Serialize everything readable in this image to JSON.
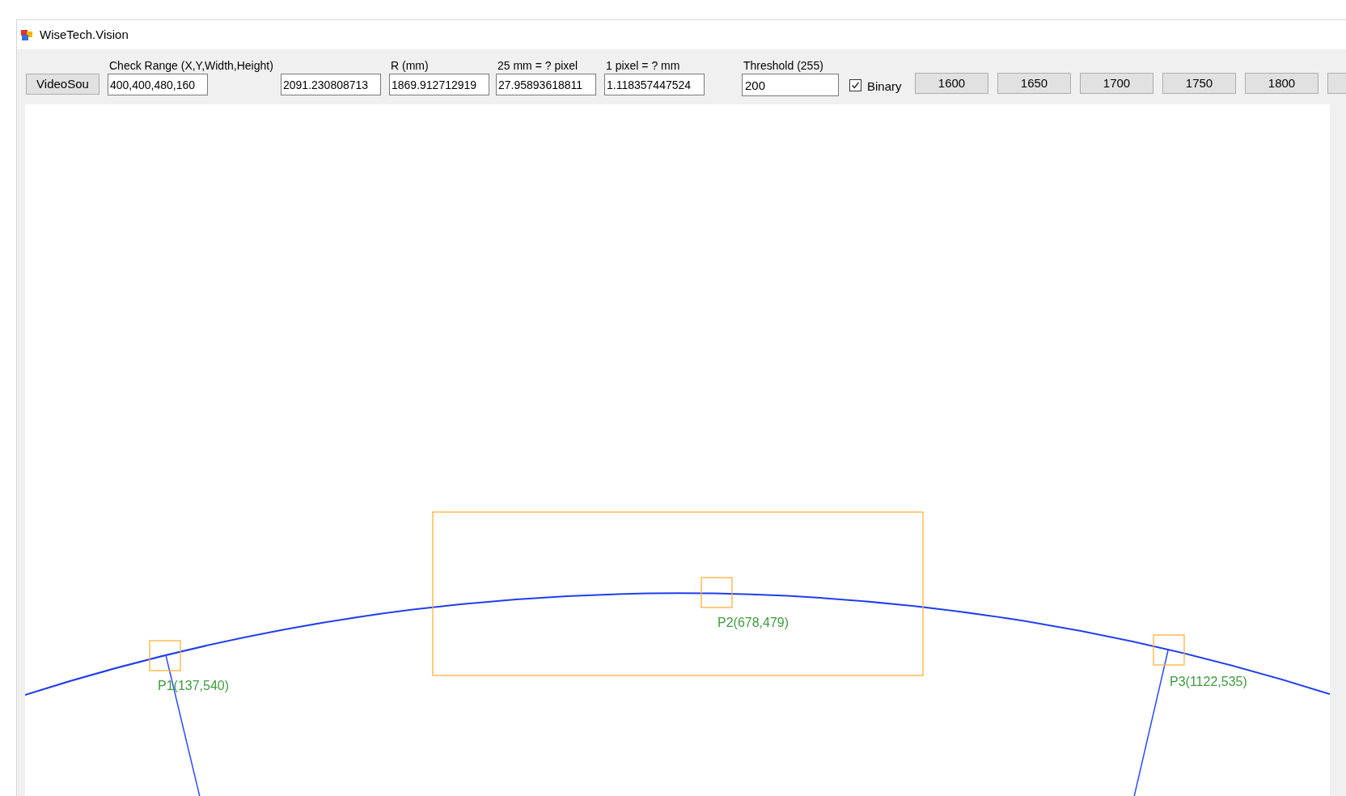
{
  "window": {
    "title": "WiseTech.Vision"
  },
  "toolbar": {
    "video_source_button": "VideoSou",
    "fields": [
      {
        "label": "Check Range (X,Y,Width,Height)",
        "value": "400,400,480,160"
      },
      {
        "value": "2091.230808713"
      },
      {
        "label": "R (mm)",
        "value": "1869.912712919"
      },
      {
        "label": "25 mm = ? pixel",
        "value": "27.95893618811"
      },
      {
        "label": "1 pixel = ? mm",
        "value": "1.118357447524"
      }
    ],
    "threshold": {
      "label": "Threshold (255)",
      "value": "200"
    },
    "binary": {
      "label": "Binary",
      "checked": true
    },
    "preset_buttons": [
      "1600",
      "1650",
      "1700",
      "1750",
      "1800"
    ]
  },
  "canvas": {
    "points": [
      {
        "label": "P1(137,540)"
      },
      {
        "label": "P2(678,479)"
      },
      {
        "label": "P3(1122,535)"
      }
    ]
  }
}
